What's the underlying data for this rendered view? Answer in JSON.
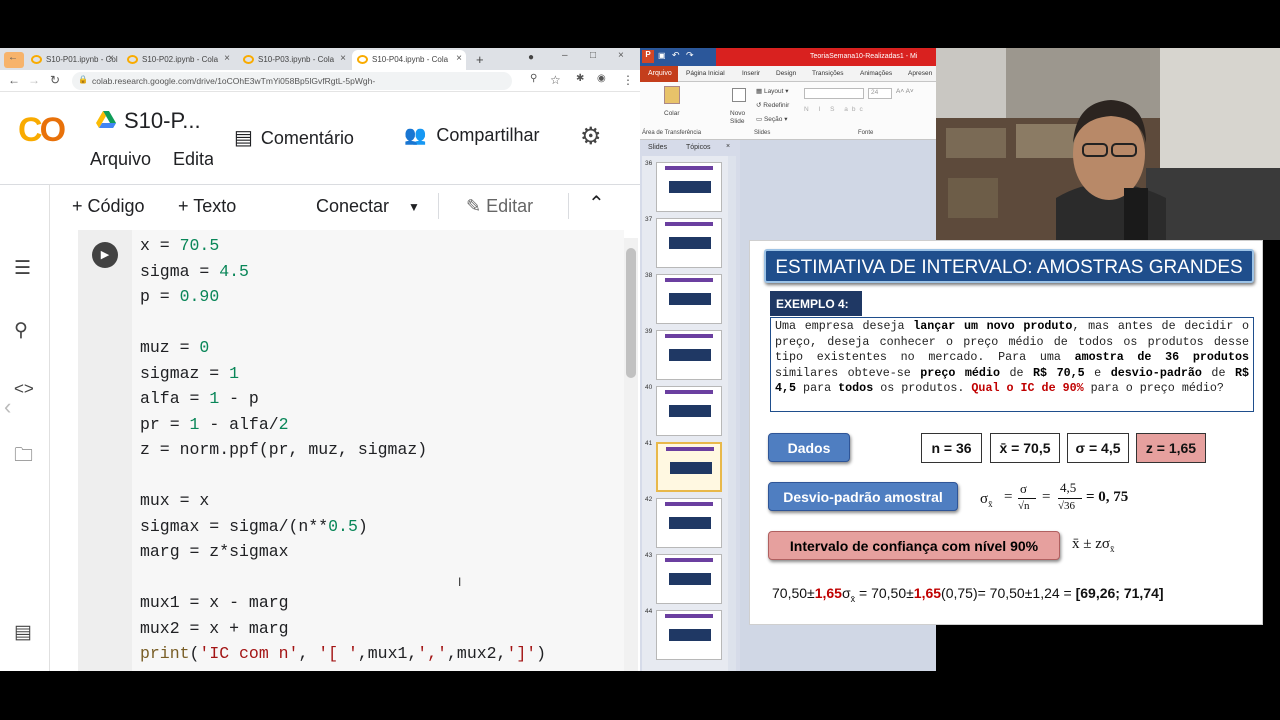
{
  "browser": {
    "tabs": [
      "S10-P01.ipynb - Cola",
      "S10-P02.ipynb - Cola",
      "S10-P03.ipynb - Cola",
      "S10-P04.ipynb - Cola"
    ],
    "url": "colab.research.google.com/drive/1oCOhE3wTmYi058Bp5lGvfRgtL-5pWgh-"
  },
  "colab": {
    "title": "S10-P...",
    "menu_file": "Arquivo",
    "menu_edit": "Edita",
    "comment": "Comentário",
    "share": "Compartilhar",
    "add_code": "+ Código",
    "add_text": "+ Texto",
    "connect": "Conectar",
    "edit": "Editar",
    "code_lines": [
      "x = 70.5",
      "sigma = 4.5",
      "p = 0.90",
      "",
      "muz = 0",
      "sigmaz = 1",
      "alfa = 1 - p",
      "pr = 1 - alfa/2",
      "z = norm.ppf(pr, muz, sigmaz)",
      "",
      "mux = x",
      "sigmax = sigma/(n**0.5)",
      "marg = z*sigmax",
      "",
      "mux1 = x - marg",
      "mux2 = x + marg",
      "print('IC com n', '[ ',mux1,',',mux2,']')"
    ]
  },
  "powerpoint": {
    "window_title": "TeoriaSemana10-Realizadas1 - Mi",
    "ribbon_tabs": [
      "Arquivo",
      "Página Inicial",
      "Inserir",
      "Design",
      "Transições",
      "Animações",
      "Apresen"
    ],
    "ribbon_labels": {
      "paste": "Colar",
      "new_slide": "Novo Slide",
      "layout": "Layout",
      "reset": "Redefinir",
      "section": "Seção",
      "font_size": "24",
      "clipboard": "Área de Transferência",
      "slides": "Slides",
      "font": "Fonte"
    },
    "panel_tabs": [
      "Slides",
      "Tópicos"
    ],
    "slide_numbers": [
      "36",
      "37",
      "38",
      "39",
      "40",
      "41",
      "42",
      "43",
      "44"
    ]
  },
  "slide": {
    "title": "ESTIMATIVA DE INTERVALO: AMOSTRAS GRANDES",
    "example": "EXEMPLO 4:",
    "problem_parts": [
      {
        "t": "Uma empresa deseja ",
        "style": ""
      },
      {
        "t": "lançar um novo produto",
        "style": "b"
      },
      {
        "t": ", mas antes de decidir o preço, deseja conhecer o preço médio de todos os produtos desse tipo existentes no mercado. Para uma ",
        "style": ""
      },
      {
        "t": "amostra de 36 produtos",
        "style": "b"
      },
      {
        "t": " similares obteve-se ",
        "style": ""
      },
      {
        "t": "preço médio",
        "style": "b"
      },
      {
        "t": " de ",
        "style": ""
      },
      {
        "t": "R$ 70,5",
        "style": "b"
      },
      {
        "t": " e ",
        "style": ""
      },
      {
        "t": "desvio-padrão",
        "style": "b"
      },
      {
        "t": " de ",
        "style": ""
      },
      {
        "t": "R$ 4,5",
        "style": "b"
      },
      {
        "t": " para ",
        "style": ""
      },
      {
        "t": "todos",
        "style": "b"
      },
      {
        "t": " os produtos. ",
        "style": ""
      },
      {
        "t": "Qual o IC de 90%",
        "style": "r"
      },
      {
        "t": " para o preço médio?",
        "style": ""
      }
    ],
    "dados": "Dados",
    "n_value": "n = 36",
    "xbar_value": "x̄ = 70,5",
    "sigma_value": "σ = 4,5",
    "z_value": "z = 1,65",
    "desvio_label": "Desvio-padrão amostral",
    "desvio_formula": {
      "sigma": "σ",
      "sqrt_n": "√n",
      "num": "4,5",
      "den": "√36",
      "result": "= 0, 75"
    },
    "intervalo_label": "Intervalo de confiança com nível 90%",
    "intervalo_formula": "x̄  ±  zσ",
    "calc_parts": [
      {
        "t": "70,50±",
        "style": ""
      },
      {
        "t": "1,65",
        "style": "r"
      },
      {
        "t": "σ",
        "style": ""
      },
      {
        "t": " = 70,50±",
        "style": ""
      },
      {
        "t": "1,65",
        "style": "r"
      },
      {
        "t": "(0,75)= 70,50±1,24 = ",
        "style": ""
      },
      {
        "t": "[69,26; 71,74]",
        "style": "b"
      }
    ]
  },
  "colors": {
    "colab_orange": "#f9ab00",
    "slide_blue": "#1f4e8c",
    "accent_red": "#c00000",
    "ppt_red": "#d9211f"
  }
}
